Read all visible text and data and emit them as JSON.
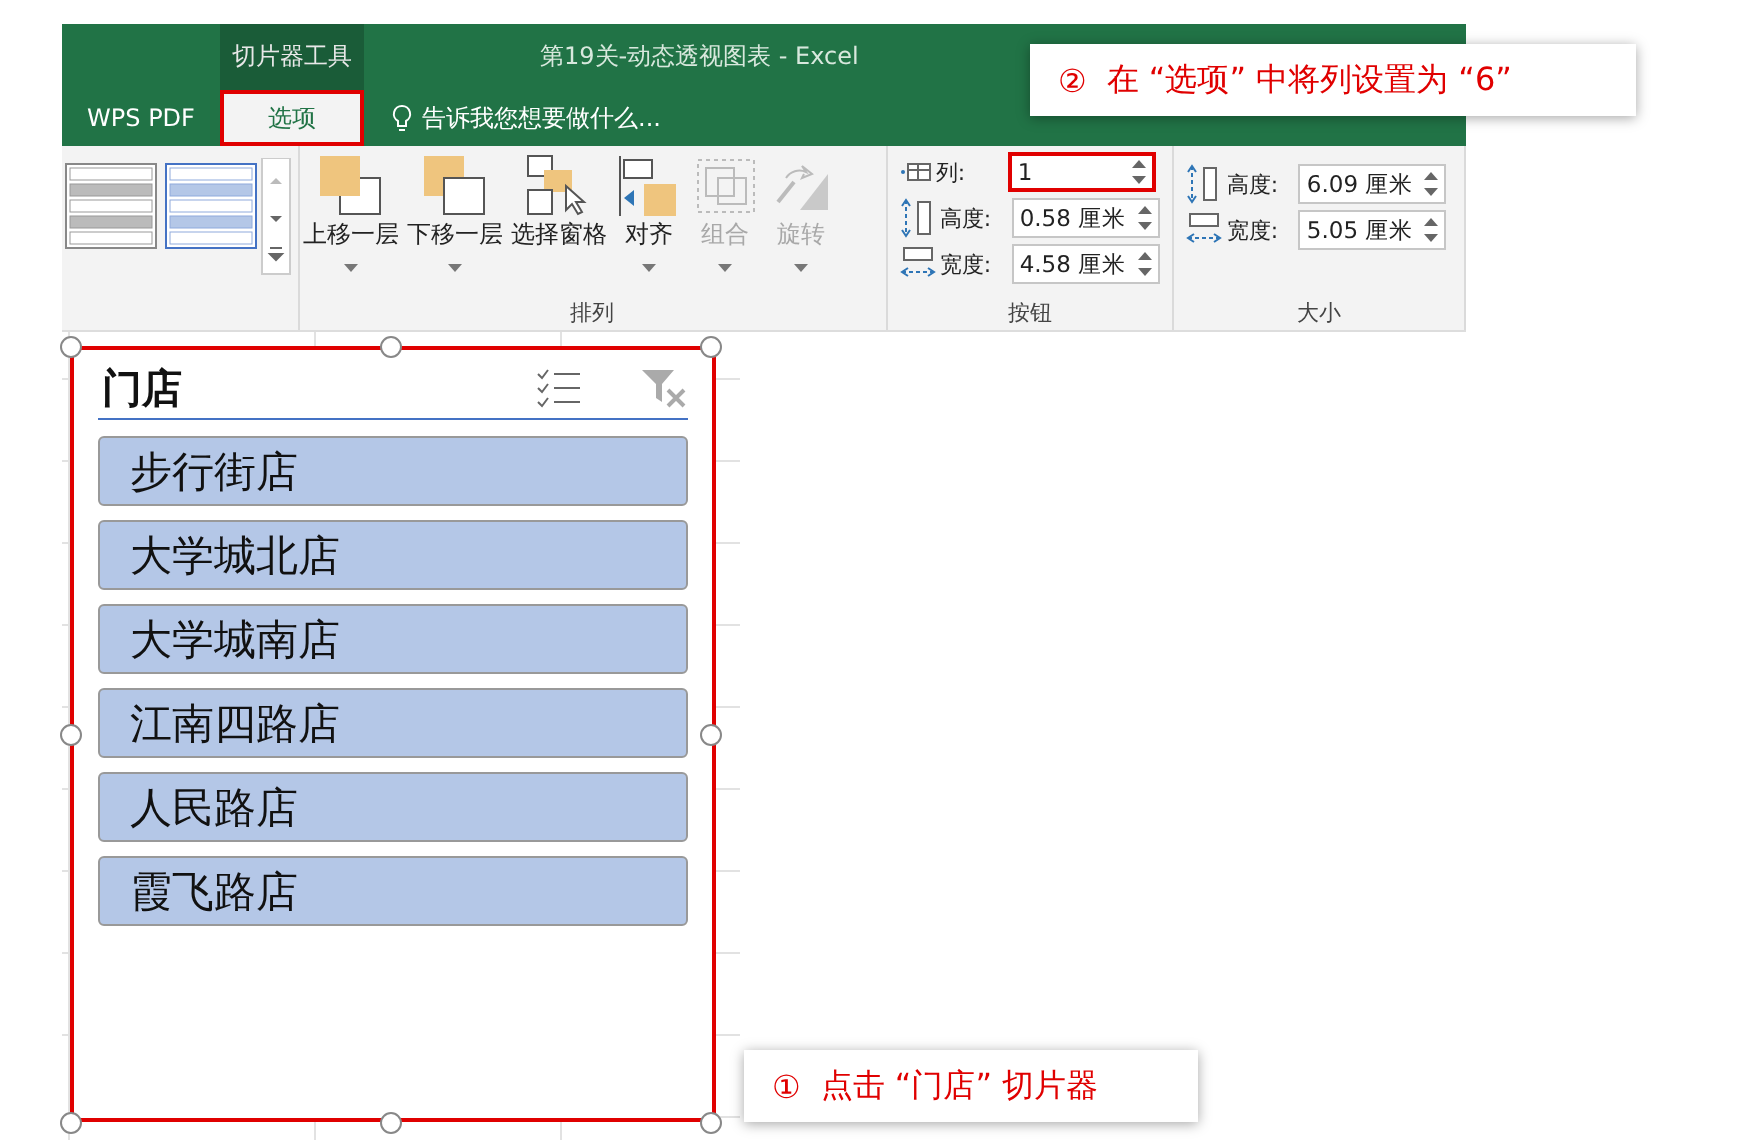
{
  "window": {
    "title": "第19关-动态透视图表 - Excel",
    "context_tab": "切片器工具"
  },
  "tabs": [
    {
      "label": "WPS PDF",
      "selected": false,
      "highlighted": false
    },
    {
      "label": "选项",
      "selected": true,
      "highlighted": true
    }
  ],
  "tell_me": {
    "placeholder": "告诉我您想要做什么..."
  },
  "arrange": {
    "label": "排列",
    "buttons": [
      {
        "kind": "forward",
        "label": "上移一层",
        "disabled": false,
        "dropdown": true
      },
      {
        "kind": "backward",
        "label": "下移一层",
        "disabled": false,
        "dropdown": true
      },
      {
        "kind": "pane",
        "label": "选择窗格",
        "disabled": false,
        "dropdown": false
      },
      {
        "kind": "align",
        "label": "对齐",
        "disabled": false,
        "dropdown": true
      },
      {
        "kind": "group",
        "label": "组合",
        "disabled": true,
        "dropdown": true
      },
      {
        "kind": "rotate",
        "label": "旋转",
        "disabled": true,
        "dropdown": true
      }
    ]
  },
  "buttons_group": {
    "label": "按钮",
    "fields": [
      {
        "kind": "columns",
        "label": "列:",
        "value": "1",
        "highlighted": true
      },
      {
        "kind": "height",
        "label": "高度:",
        "value": "0.58 厘米",
        "highlighted": false
      },
      {
        "kind": "width",
        "label": "宽度:",
        "value": "4.58 厘米",
        "highlighted": false
      }
    ]
  },
  "size_group": {
    "label": "大小",
    "fields": [
      {
        "kind": "height",
        "label": "高度:",
        "value": "6.09 厘米",
        "highlighted": false
      },
      {
        "kind": "width",
        "label": "宽度:",
        "value": "5.05 厘米",
        "highlighted": false
      }
    ]
  },
  "slicer": {
    "title": "门店",
    "highlighted": true,
    "items": [
      {
        "label": "步行街店",
        "selected": true
      },
      {
        "label": "大学城北店",
        "selected": true
      },
      {
        "label": "大学城南店",
        "selected": true
      },
      {
        "label": "江南四路店",
        "selected": true
      },
      {
        "label": "人民路店",
        "selected": true
      },
      {
        "label": "霞飞路店",
        "selected": true
      }
    ]
  },
  "callouts": [
    {
      "number": "②",
      "text": "在 “选项” 中将列设置为 “6”"
    },
    {
      "number": "①",
      "text": "点击 “门店” 切片器"
    }
  ]
}
